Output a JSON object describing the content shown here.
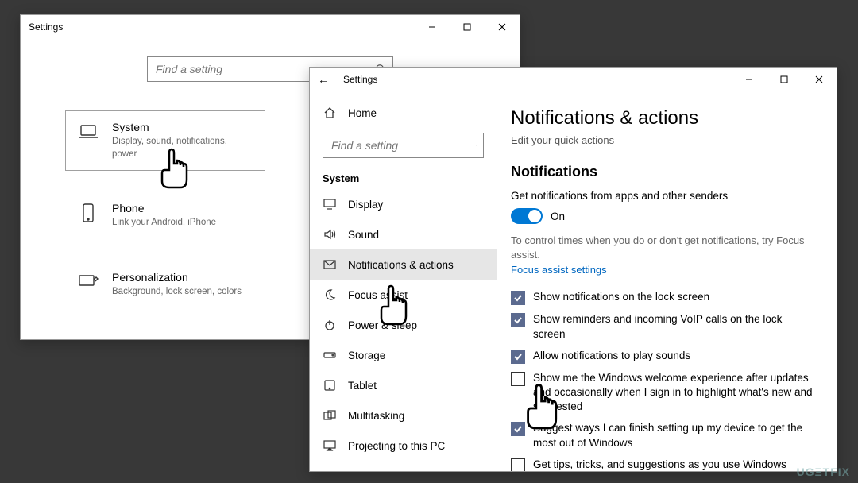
{
  "win_back": {
    "title": "Settings",
    "search_placeholder": "Find a setting",
    "categories": [
      {
        "key": "system",
        "icon": "laptop",
        "title": "System",
        "sub": "Display, sound, notifications, power",
        "selected": true
      },
      {
        "key": "phone",
        "icon": "phone",
        "title": "Phone",
        "sub": "Link your Android, iPhone",
        "selected": false
      },
      {
        "key": "personalization",
        "icon": "personalize",
        "title": "Personalization",
        "sub": "Background, lock screen, colors",
        "selected": false
      }
    ]
  },
  "win_front": {
    "title": "Settings",
    "sidebar": {
      "home": "Home",
      "search_placeholder": "Find a setting",
      "heading": "System",
      "items": [
        {
          "key": "display",
          "icon": "display",
          "label": "Display"
        },
        {
          "key": "sound",
          "icon": "sound",
          "label": "Sound"
        },
        {
          "key": "notifications",
          "icon": "notify",
          "label": "Notifications & actions",
          "selected": true
        },
        {
          "key": "focus",
          "icon": "focus",
          "label": "Focus assist"
        },
        {
          "key": "power",
          "icon": "power",
          "label": "Power & sleep"
        },
        {
          "key": "storage",
          "icon": "storage",
          "label": "Storage"
        },
        {
          "key": "tablet",
          "icon": "tablet",
          "label": "Tablet"
        },
        {
          "key": "multitasking",
          "icon": "multi",
          "label": "Multitasking"
        },
        {
          "key": "projecting",
          "icon": "project",
          "label": "Projecting to this PC"
        }
      ]
    },
    "content": {
      "h1": "Notifications & actions",
      "lead": "Edit your quick actions",
      "h2": "Notifications",
      "toggle_label": "Get notifications from apps and other senders",
      "toggle_state": "On",
      "hint": "To control times when you do or don't get notifications, try Focus assist.",
      "link": "Focus assist settings",
      "checks": [
        {
          "checked": true,
          "label": "Show notifications on the lock screen"
        },
        {
          "checked": true,
          "label": "Show reminders and incoming VoIP calls on the lock screen"
        },
        {
          "checked": true,
          "label": "Allow notifications to play sounds"
        },
        {
          "checked": false,
          "label": "Show me the Windows welcome experience after updates and occasionally when I sign in to highlight what's new and suggested"
        },
        {
          "checked": true,
          "label": "Suggest ways I can finish setting up my device to get the most out of Windows"
        },
        {
          "checked": false,
          "label": "Get tips, tricks, and suggestions as you use Windows"
        }
      ]
    }
  },
  "watermark": "UGΞTFIX"
}
